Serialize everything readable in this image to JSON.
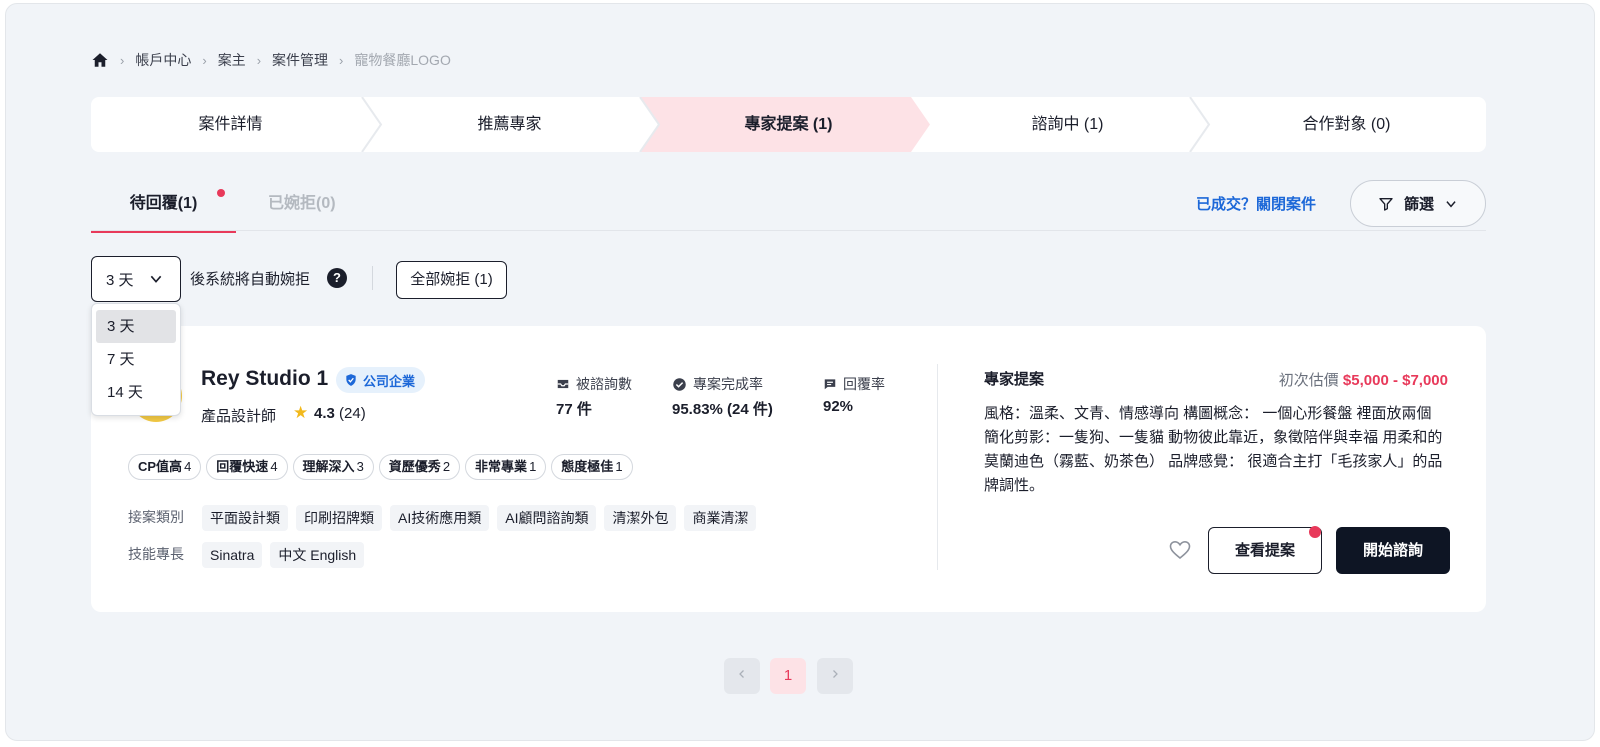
{
  "breadcrumb": {
    "home_icon": "home-icon",
    "items": [
      "帳戶中心",
      "案主",
      "案件管理",
      "寵物餐廳LOGO"
    ]
  },
  "steps": [
    {
      "label": "案件詳情",
      "active": false
    },
    {
      "label": "推薦專家",
      "active": false
    },
    {
      "label": "專家提案 (1)",
      "active": true
    },
    {
      "label": "諮詢中 (1)",
      "active": false
    },
    {
      "label": "合作對象 (0)",
      "active": false
    }
  ],
  "tabs": {
    "pending": "待回覆(1)",
    "declined": "已婉拒(0)"
  },
  "close_case_link": "已成交？關閉案件",
  "filter": {
    "label": "篩選",
    "icon": "filter-icon"
  },
  "auto_reject": {
    "selected": "3 天",
    "options": [
      "3 天",
      "7 天",
      "14 天"
    ],
    "text": "後系統將自動婉拒",
    "help_icon": "question-circle-icon",
    "reject_all_label": "全部婉拒 (1)"
  },
  "expert": {
    "name": "Rey Studio 1",
    "badge": "公司企業",
    "role": "產品設計師",
    "rating": "4.3",
    "rating_count": "(24)",
    "stats": [
      {
        "label": "被諮詢數",
        "value": "77 件",
        "icon": "inbox-icon"
      },
      {
        "label": "專案完成率",
        "value": "95.83% (24 件)",
        "icon": "check-circle-icon"
      },
      {
        "label": "回覆率",
        "value": "92%",
        "icon": "message-icon"
      }
    ],
    "tags": [
      {
        "label": "CP值高",
        "count": "4"
      },
      {
        "label": "回覆快速",
        "count": "4"
      },
      {
        "label": "理解深入",
        "count": "3"
      },
      {
        "label": "資歷優秀",
        "count": "2"
      },
      {
        "label": "非常專業",
        "count": "1"
      },
      {
        "label": "態度極佳",
        "count": "1"
      }
    ],
    "category_label": "接案類別",
    "categories": [
      "平面設計類",
      "印刷招牌類",
      "AI技術應用類",
      "AI顧問諮詢類",
      "清潔外包",
      "商業清潔"
    ],
    "skills_label": "技能專長",
    "skills": [
      "Sinatra",
      "中文 English"
    ]
  },
  "proposal": {
    "title": "專家提案",
    "price_label": "初次估價",
    "price": "$5,000 - $7,000",
    "body": "風格：溫柔、文青、情感導向  構圖概念： 一個心形餐盤 裡面放兩個簡化剪影：一隻狗、一隻貓 動物彼此靠近，象徵陪伴與幸福 用柔和的莫蘭迪色（霧藍、奶茶色）  品牌感覺： 很適合主打「毛孩家人」的品牌調性。",
    "view_label": "查看提案",
    "start_label": "開始諮詢"
  },
  "pagination": {
    "current": "1",
    "prev_icon": "chevron-left-icon",
    "next_icon": "chevron-right-icon"
  },
  "colors": {
    "accent": "#e8395a",
    "link": "#1d68d8",
    "dark": "#0e1524",
    "active_step": "#fde2e6"
  }
}
